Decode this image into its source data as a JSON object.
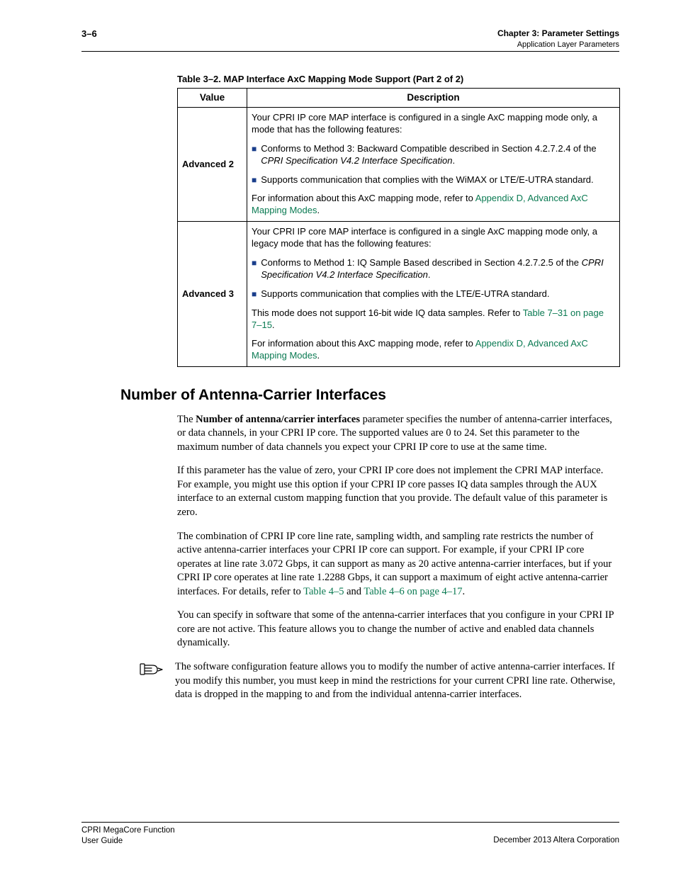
{
  "header": {
    "page_no": "3–6",
    "chapter": "Chapter 3: Parameter Settings",
    "sub": "Application Layer Parameters"
  },
  "table_caption": "Table 3–2. MAP Interface AxC Mapping Mode Support (Part 2 of 2)",
  "table": {
    "th_value": "Value",
    "th_desc": "Description",
    "rows": [
      {
        "value": "Advanced 2",
        "p1": "Your CPRI IP core MAP interface is configured in a single AxC mapping mode only, a mode that has the following features:",
        "b1a": "Conforms to Method 3: Backward Compatible described in Section 4.2.7.2.4 of the ",
        "b1b": "CPRI Specification V4.2 Interface Specification",
        "b1c": ".",
        "b2": "Supports communication that complies with the WiMAX or LTE/E-UTRA standard.",
        "p2a": "For information about this AxC mapping mode, refer to ",
        "p2b": "Appendix D, Advanced AxC Mapping Modes",
        "p2c": "."
      },
      {
        "value": "Advanced 3",
        "p1": "Your CPRI IP core MAP interface is configured in a single AxC mapping mode only, a legacy mode that has the following features:",
        "b1a": "Conforms to Method 1: IQ Sample Based described in Section 4.2.7.2.5 of the ",
        "b1b": "CPRI Specification V4.2 Interface Specification",
        "b1c": ".",
        "b2": "Supports communication that complies with the LTE/E-UTRA standard.",
        "p2a": "This mode does not support 16-bit wide IQ data samples. Refer to ",
        "p2b": "Table 7–31 on page 7–15",
        "p2c": ".",
        "p3a": "For information about this AxC mapping mode, refer to ",
        "p3b": "Appendix D, Advanced AxC Mapping Modes",
        "p3c": "."
      }
    ]
  },
  "section_heading": "Number of Antenna-Carrier Interfaces",
  "para1_a": "The ",
  "para1_b": "Number of antenna/carrier interfaces",
  "para1_c": " parameter specifies the number of antenna-carrier interfaces, or data channels, in your CPRI IP core. The supported values are 0 to 24. Set this parameter to the maximum number of data channels you expect your CPRI IP core to use at the same time.",
  "para2": "If this parameter has the value of zero, your CPRI IP core does not implement the CPRI MAP interface. For example, you might use this option if your CPRI IP core passes IQ data samples through the AUX interface to an external custom mapping function that you provide. The default value of this parameter is zero.",
  "para3_a": "The combination of CPRI IP core line rate, sampling width, and sampling rate restricts the number of active antenna-carrier interfaces your CPRI IP core can support. For example, if your CPRI IP core operates at line rate 3.072 Gbps, it can support as many as 20 active antenna-carrier interfaces, but if your CPRI IP core operates at line rate 1.2288 Gbps, it can support a maximum of eight active antenna-carrier interfaces. For details, refer to ",
  "para3_b": "Table 4–5",
  "para3_c": " and ",
  "para3_d": "Table 4–6 on page 4–17",
  "para3_e": ".",
  "para4": "You can specify in software that some of the antenna-carrier interfaces that you configure in your CPRI IP core are not active. This feature allows you to change the number of active and enabled data channels dynamically.",
  "note": "The software configuration feature allows you to modify the number of active antenna-carrier interfaces. If you modify this number, you must keep in mind the restrictions for your current CPRI line rate. Otherwise, data is dropped in the mapping to and from the individual antenna-carrier interfaces.",
  "footer": {
    "left1": "CPRI MegaCore Function",
    "left2": "User Guide",
    "right": "December 2013   Altera Corporation"
  }
}
